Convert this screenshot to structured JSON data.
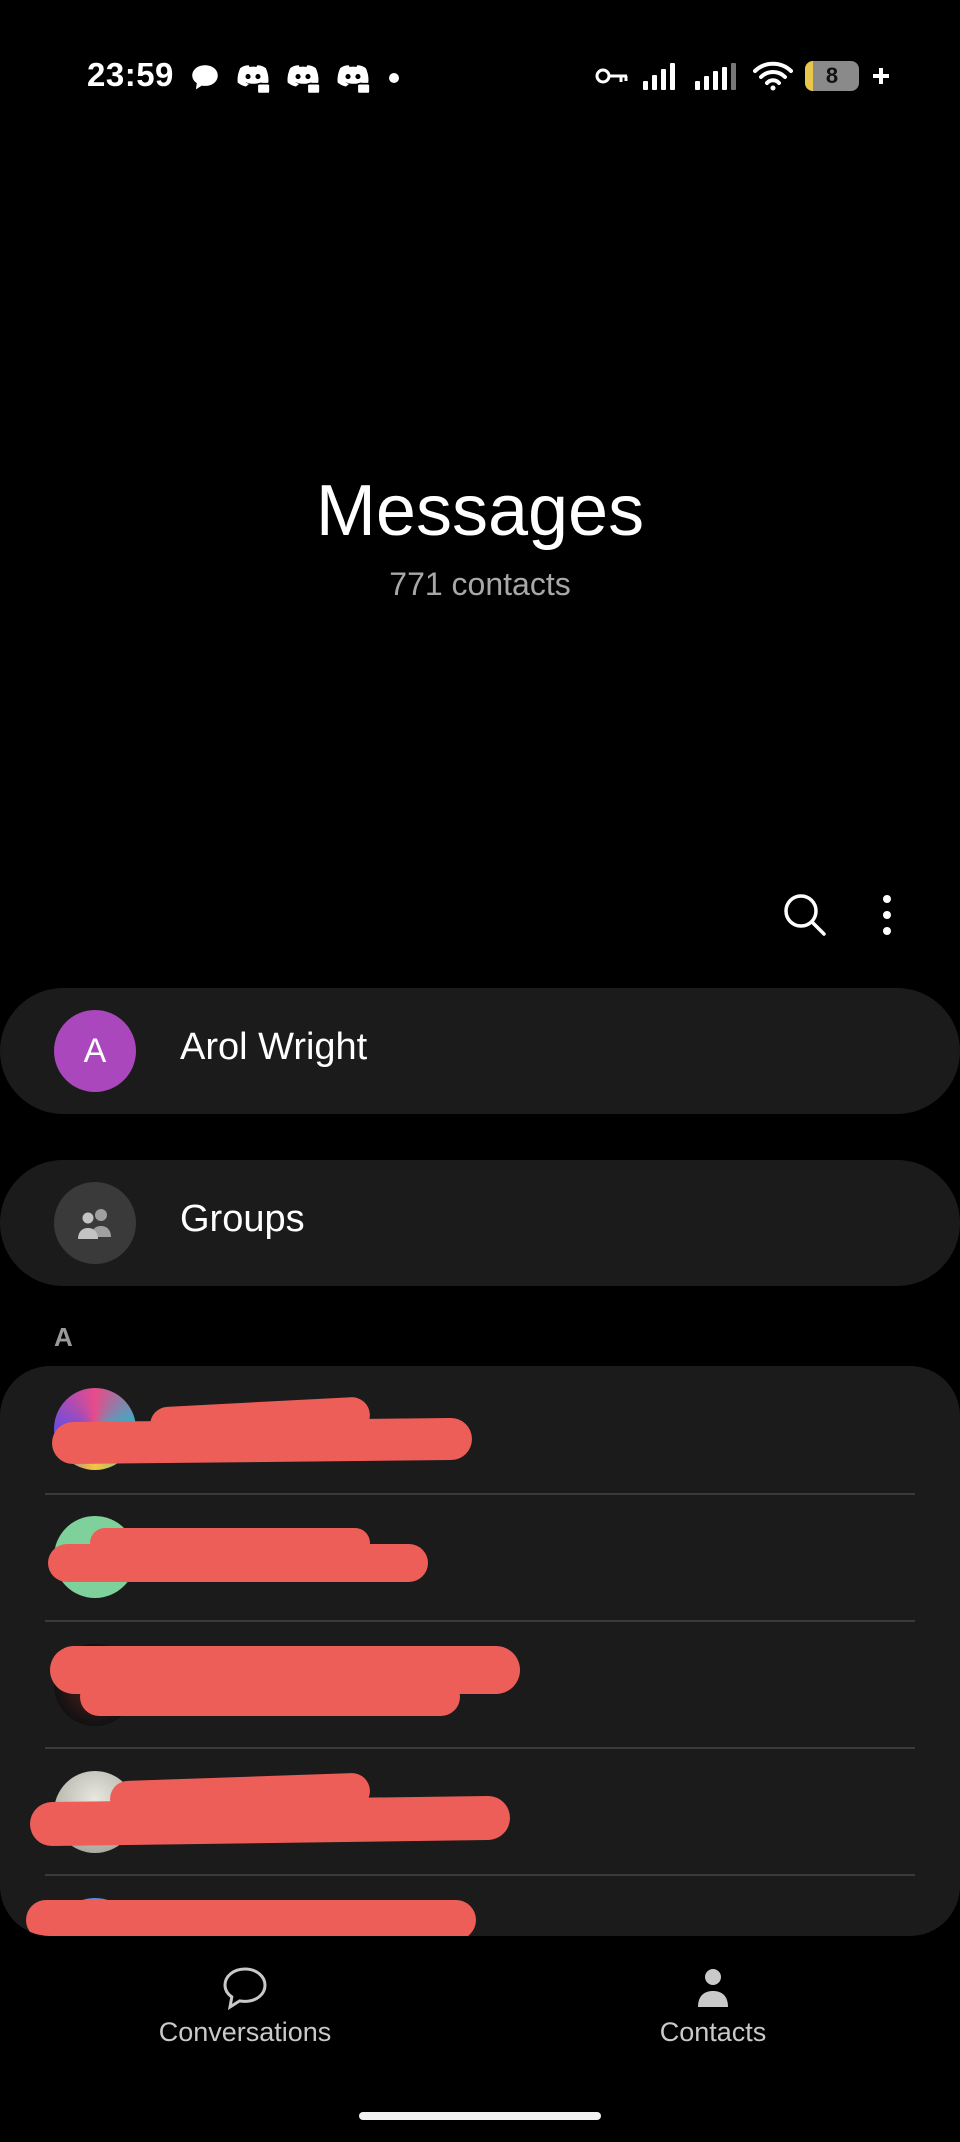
{
  "status_bar": {
    "time": "23:59",
    "battery_level": "8",
    "left_icons": [
      "chat-bubble-icon",
      "discord-icon",
      "discord-icon",
      "discord-icon",
      "dot-icon"
    ],
    "right_icons": [
      "vpn-key-icon",
      "signal-icon",
      "signal-icon",
      "wifi-icon",
      "battery-icon"
    ]
  },
  "header": {
    "title": "Messages",
    "subtitle": "771 contacts"
  },
  "toolbar": {
    "icons": [
      "search-icon",
      "more-vert-icon"
    ]
  },
  "profile": {
    "initial": "A",
    "name": "Arol Wright",
    "avatar_color": "#ab47bc"
  },
  "groups": {
    "label": "Groups"
  },
  "contacts": {
    "section_letter": "A",
    "items_redacted_count_visible": 5
  },
  "bottom_nav": {
    "items": [
      {
        "label": "Conversations",
        "icon": "chat-bubble-outline-icon"
      },
      {
        "label": "Contacts",
        "icon": "person-icon"
      }
    ]
  },
  "colors": {
    "background": "#000000",
    "card": "#1b1b1b",
    "redaction": "#ee5e58"
  }
}
